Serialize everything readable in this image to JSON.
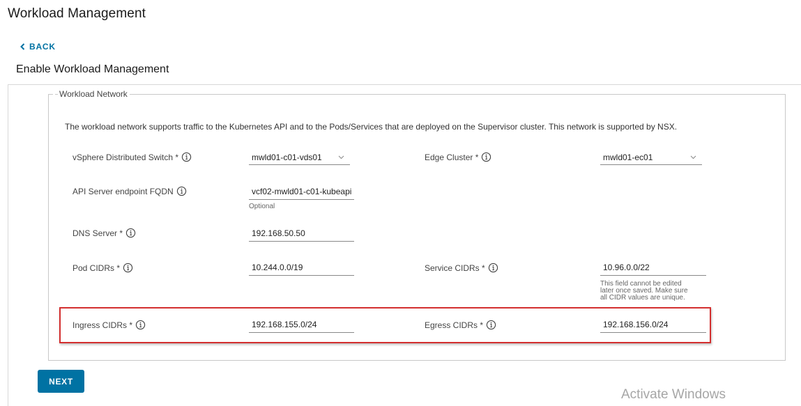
{
  "app": {
    "title": "Workload Management"
  },
  "nav": {
    "back_label": "BACK"
  },
  "page": {
    "title": "Enable Workload Management"
  },
  "section": {
    "legend": "Workload Network",
    "description": "The workload network supports traffic to the Kubernetes API and to the Pods/Services that are deployed on the Supervisor cluster. This network is supported by NSX."
  },
  "fields": {
    "vds": {
      "label": "vSphere Distributed Switch *",
      "value": "mwld01-c01-vds01"
    },
    "edge_cluster": {
      "label": "Edge Cluster *",
      "value": "mwld01-ec01"
    },
    "api_fqdn": {
      "label": "API Server endpoint FQDN",
      "value": "vcf02-mwld01-c01-kubeapi",
      "helper": "Optional"
    },
    "dns": {
      "label": "DNS Server *",
      "value": "192.168.50.50"
    },
    "pod_cidrs": {
      "label": "Pod CIDRs *",
      "value": "10.244.0.0/19"
    },
    "service_cidrs": {
      "label": "Service CIDRs *",
      "value": "10.96.0.0/22",
      "helper_lines": [
        "This field cannot be edited",
        "later once saved. Make sure",
        "all CIDR values are unique."
      ]
    },
    "ingress_cidrs": {
      "label": "Ingress CIDRs *",
      "value": "192.168.155.0/24"
    },
    "egress_cidrs": {
      "label": "Egress CIDRs *",
      "value": "192.168.156.0/24"
    }
  },
  "actions": {
    "next_label": "NEXT"
  },
  "watermark": {
    "text": "Activate Windows"
  },
  "colors": {
    "accent": "#0072a3",
    "highlight": "#d32f2f"
  },
  "icons": {
    "back": "chevron-left-icon",
    "info": "info-icon",
    "dropdown": "chevron-down-icon"
  }
}
